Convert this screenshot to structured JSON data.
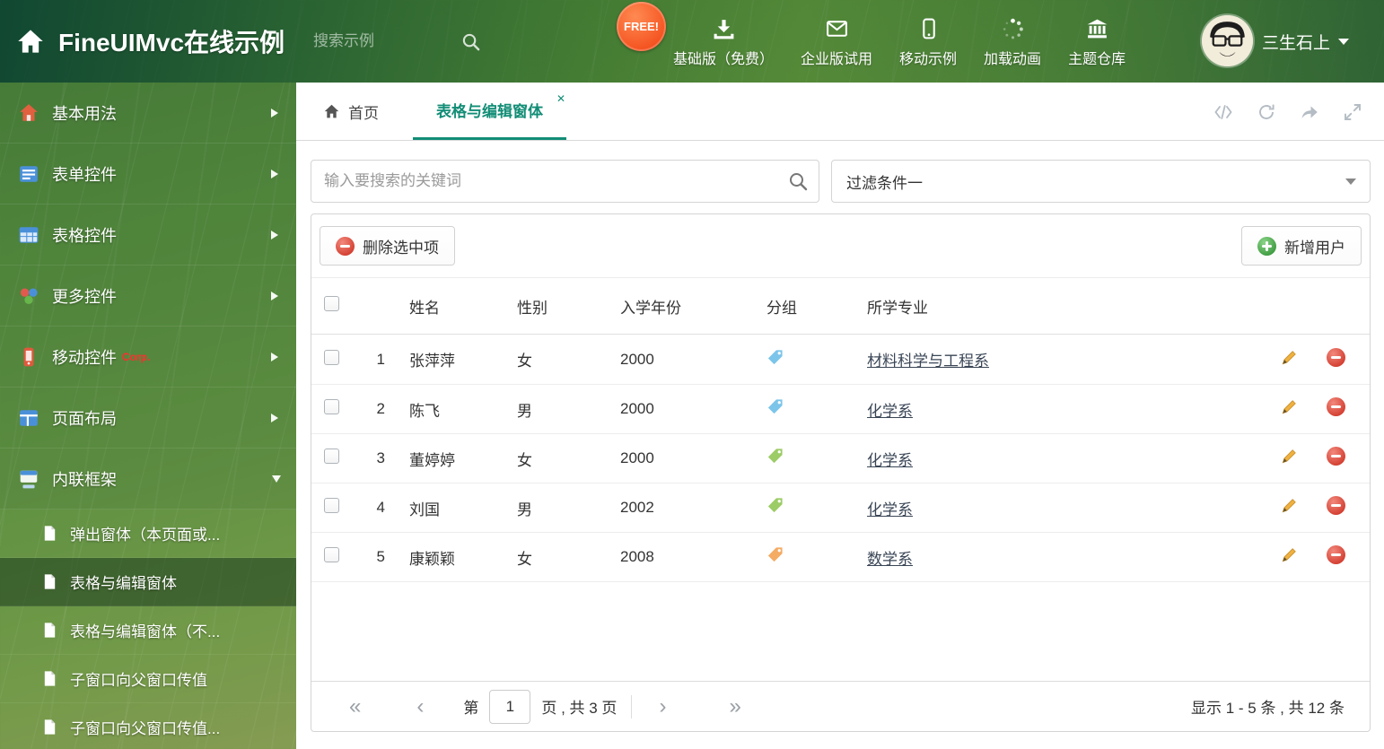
{
  "header": {
    "title": "FineUIMvc在线示例",
    "search_placeholder": "搜索示例",
    "free_badge": "FREE!",
    "nav": [
      {
        "label": "基础版（免费）"
      },
      {
        "label": "企业版试用"
      },
      {
        "label": "移动示例"
      },
      {
        "label": "加载动画"
      },
      {
        "label": "主题仓库"
      }
    ],
    "username": "三生石上"
  },
  "sidebar": {
    "items": [
      {
        "label": "基本用法"
      },
      {
        "label": "表单控件"
      },
      {
        "label": "表格控件"
      },
      {
        "label": "更多控件"
      },
      {
        "label": "移动控件",
        "badge": "Corp."
      },
      {
        "label": "页面布局"
      },
      {
        "label": "内联框架"
      }
    ],
    "subitems": [
      {
        "label": "弹出窗体（本页面或..."
      },
      {
        "label": "表格与编辑窗体"
      },
      {
        "label": "表格与编辑窗体（不..."
      },
      {
        "label": "子窗口向父窗口传值"
      },
      {
        "label": "子窗口向父窗口传值..."
      }
    ]
  },
  "tabs": {
    "home_label": "首页",
    "active_label": "表格与编辑窗体"
  },
  "filters": {
    "search_placeholder": "输入要搜索的关键词",
    "filter_value": "过滤条件一"
  },
  "toolbar": {
    "delete_label": "删除选中项",
    "add_label": "新增用户"
  },
  "table": {
    "headers": {
      "name": "姓名",
      "gender": "性别",
      "year": "入学年份",
      "group": "分组",
      "major": "所学专业"
    },
    "rows": [
      {
        "num": "1",
        "name": "张萍萍",
        "gender": "女",
        "year": "2000",
        "tag_color": "#7cc5ea",
        "major": "材料科学与工程系"
      },
      {
        "num": "2",
        "name": "陈飞",
        "gender": "男",
        "year": "2000",
        "tag_color": "#7cc5ea",
        "major": "化学系"
      },
      {
        "num": "3",
        "name": "董婷婷",
        "gender": "女",
        "year": "2000",
        "tag_color": "#9ccc66",
        "major": "化学系"
      },
      {
        "num": "4",
        "name": "刘国",
        "gender": "男",
        "year": "2002",
        "tag_color": "#9ccc66",
        "major": "化学系"
      },
      {
        "num": "5",
        "name": "康颖颖",
        "gender": "女",
        "year": "2008",
        "tag_color": "#f4ab64",
        "major": "数学系"
      }
    ]
  },
  "pagination": {
    "page_label": "第",
    "page_value": "1",
    "page_total": "页 , 共 3 页",
    "summary": "显示 1 - 5 条 , 共 12 条"
  },
  "icons": {
    "close": "✕",
    "first": "«",
    "prev": "‹",
    "next": "›",
    "last": "»"
  },
  "colors": {
    "accent": "#128d76",
    "delete_red": "#d23c2e",
    "add_green": "#3c9a3f",
    "pencil_orange": "#efb13f"
  }
}
